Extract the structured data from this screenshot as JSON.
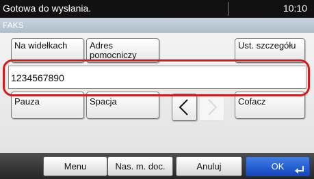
{
  "status": {
    "message": "Gotowa do wysłania.",
    "time": "10:10"
  },
  "mode": {
    "label": "FAKS"
  },
  "keys": {
    "row1": {
      "on_hook": "Na widełkach",
      "address_helper": "Adres pomocniczy",
      "detail_settings": "Ust. szczegółu"
    },
    "row2": {
      "pause": "Pauza",
      "space": "Spacja",
      "back_space": "Cofacz"
    }
  },
  "number_input": {
    "value": "1234567890"
  },
  "arrows": {
    "left_icon": "chevron-left-icon",
    "right_icon": "chevron-right-icon",
    "right_enabled": false
  },
  "bottom": {
    "menu": "Menu",
    "scan_doc": "Nas. m. doc.",
    "cancel": "Anuluj",
    "ok": "OK",
    "ok_icon": "enter-icon"
  },
  "colors": {
    "highlight": "#d61a1a",
    "ok_button": "#2a5fd6",
    "status_bar": "#111111",
    "mode_strip": "#b9c6d2"
  }
}
